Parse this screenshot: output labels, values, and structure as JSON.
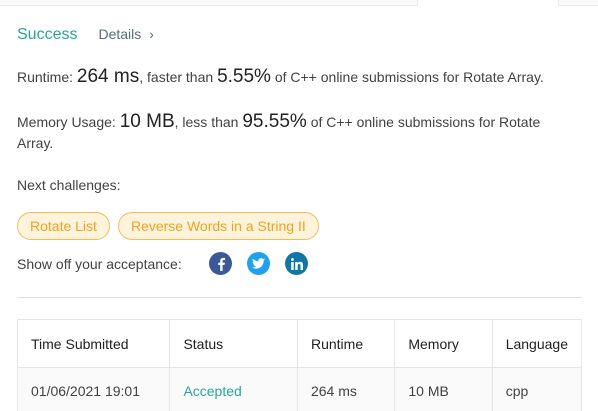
{
  "result": {
    "status": "Success",
    "details_label": "Details",
    "details_chevron": "›"
  },
  "runtime": {
    "label": "Runtime:",
    "value": "264 ms",
    "faster_text": ", faster than",
    "percent": "5.55%",
    "suffix": "of C++ online submissions for Rotate Array."
  },
  "memory": {
    "label": "Memory Usage:",
    "value": "10 MB",
    "less_text": ", less than",
    "percent": "95.55%",
    "suffix": "of C++ online submissions for Rotate Array."
  },
  "next": {
    "label": "Next challenges:",
    "challenges": [
      "Rotate List",
      "Reverse Words in a String II"
    ]
  },
  "share": {
    "label": "Show off your acceptance:",
    "networks": [
      "facebook-icon",
      "twitter-icon",
      "linkedin-icon"
    ]
  },
  "table": {
    "headers": [
      "Time Submitted",
      "Status",
      "Runtime",
      "Memory",
      "Language"
    ],
    "rows": [
      [
        "01/06/2021 19:01",
        "Accepted",
        "264 ms",
        "10 MB",
        "cpp"
      ]
    ]
  },
  "colors": {
    "success": "#26a69a",
    "tag_text": "#f0a31a",
    "tag_bg": "#fff3dc",
    "facebook": "#3b5998",
    "twitter": "#1da1f2",
    "linkedin": "#0e76a8"
  }
}
